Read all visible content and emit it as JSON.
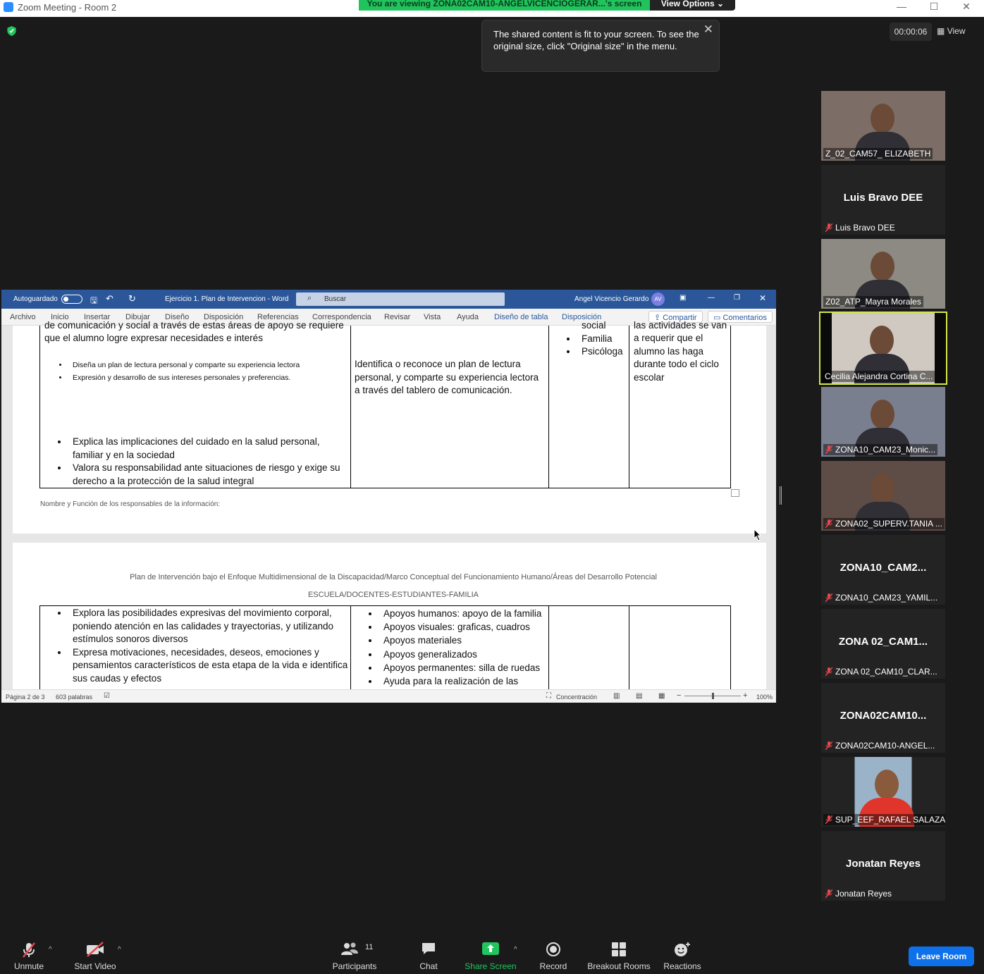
{
  "window": {
    "title": "Zoom Meeting - Room 2",
    "banner": "You are viewing ZONA02CAM10-ANGELVICENCIOGERAR...'s screen",
    "view_options": "View Options",
    "minimize_icon": "minimize-icon",
    "maximize_icon": "maximize-icon",
    "close_icon": "close-icon"
  },
  "tooltip": {
    "text": "The shared content is fit to your screen. To see the original size, click \"Original size\" in the menu."
  },
  "header": {
    "timer": "00:00:06",
    "view_label": "View"
  },
  "word": {
    "autosave": "Autoguardado",
    "doc_title": "Ejercicio 1. Plan de Intervencion  -  Word",
    "search_placeholder": "Buscar",
    "user": "Angel Vicencio Gerardo",
    "user_initials": "AV",
    "tabs": [
      "Archivo",
      "Inicio",
      "Insertar",
      "Dibujar",
      "Diseño",
      "Disposición",
      "Referencias",
      "Correspondencia",
      "Revisar",
      "Vista",
      "Ayuda",
      "Diseño de tabla",
      "Disposición"
    ],
    "share": "Compartir",
    "comments": "Comentarios",
    "page1": {
      "cut_text": "de comunicación y social a través de estas áreas de apoyo se requiere",
      "intro": "que el alumno logre expresar necesidades e interés",
      "small_bullets": [
        "Diseña un plan de lectura personal y comparte su experiencia lectora",
        "Expresión y desarrollo de sus intereses personales y preferencias."
      ],
      "bullets": [
        "Explica las implicaciones del cuidado en la salud personal, familiar y en la sociedad",
        "Valora su responsabilidad ante situaciones de riesgo y exige su derecho a la protección de la salud integral"
      ],
      "col2": "Identifica o reconoce un plan de lectura personal, y comparte su experiencia lectora a través del tablero de comunicación.",
      "col3_cut": "social",
      "col3": [
        "Familia",
        "Psicóloga"
      ],
      "col4_cut": "las actividades se van",
      "col4": "a requerir que el alumno las haga durante todo el ciclo escolar",
      "footer": "Nombre y Función de los responsables de la información:"
    },
    "page2": {
      "heading": "Plan de Intervención bajo el Enfoque Multidimensional de la Discapacidad/Marco Conceptual del Funcionamiento Humano/Áreas del Desarrollo Potencial",
      "subheading": "ESCUELA/DOCENTES-ESTUDIANTES-FAMILIA",
      "col1": [
        "Explora las posibilidades expresivas del movimiento corporal, poniendo atención en las calidades y trayectorias, y utilizando estímulos sonoros diversos",
        "Expresa motivaciones, necesidades, deseos, emociones y pensamientos característicos de esta etapa de la vida e identifica sus caudas y efectos"
      ],
      "col2": [
        "Apoyos humanos: apoyo de la familia",
        "Apoyos visuales: graficas, cuadros",
        "Apoyos materiales",
        "Apoyos generalizados",
        "Apoyos permanentes: silla de ruedas",
        "Ayuda para la realización de las"
      ]
    },
    "status": {
      "page": "Página 2 de 3",
      "words": "603 palabras",
      "focus": "Concentración",
      "zoom": "100%"
    }
  },
  "participants": [
    {
      "label": "Z_02_CAM57_ ELIZABETH",
      "big": "",
      "muted": false,
      "video": true
    },
    {
      "label": "Luis Bravo DEE",
      "big": "Luis Bravo DEE",
      "muted": true,
      "video": false
    },
    {
      "label": "Z02_ATP_Mayra Morales",
      "big": "",
      "muted": false,
      "video": true
    },
    {
      "label": "Cecilia Alejandra Cortina C...",
      "big": "",
      "muted": false,
      "video": true
    },
    {
      "label": "ZONA10_CAM23_Monic...",
      "big": "",
      "muted": true,
      "video": true
    },
    {
      "label": "ZONA02_SUPERV.TANIA ...",
      "big": "",
      "muted": true,
      "video": true
    },
    {
      "label": "ZONA10_CAM23_YAMIL...",
      "big": "ZONA10_CAM2...",
      "muted": true,
      "video": false
    },
    {
      "label": "ZONA 02_CAM10_CLAR...",
      "big": "ZONA  02_CAM1...",
      "muted": true,
      "video": false
    },
    {
      "label": "ZONA02CAM10-ANGEL...",
      "big": "ZONA02CAM10...",
      "muted": true,
      "video": false
    },
    {
      "label": "SUP_EEF_RAFAEL SALAZAR",
      "big": "",
      "muted": true,
      "video": true
    },
    {
      "label": "Jonatan Reyes",
      "big": "Jonatan Reyes",
      "muted": true,
      "video": false
    }
  ],
  "toolbar": {
    "unmute": "Unmute",
    "start_video": "Start Video",
    "participants": "Participants",
    "participants_count": "11",
    "chat": "Chat",
    "share_screen": "Share Screen",
    "record": "Record",
    "breakout_rooms": "Breakout Rooms",
    "reactions": "Reactions",
    "leave": "Leave Room"
  },
  "colors": {
    "banner": "#21c35d",
    "word_title": "#2b579a",
    "leave": "#0e71eb",
    "active_speaker": "#d4e64a",
    "muted": "#e5484d"
  }
}
